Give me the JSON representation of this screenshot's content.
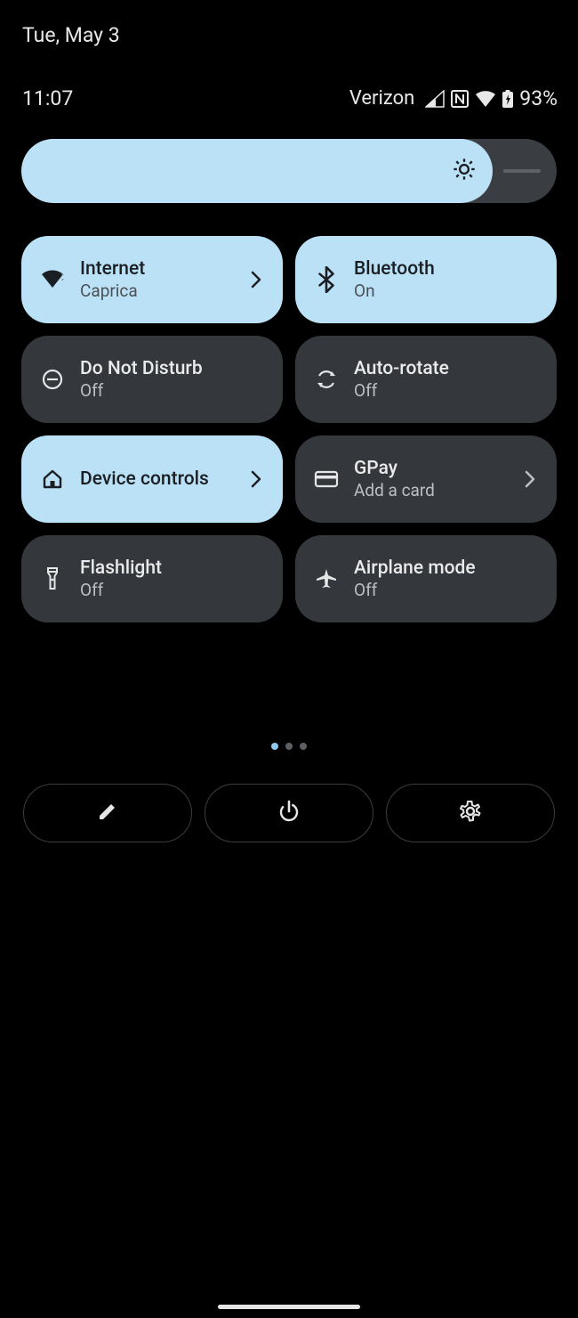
{
  "date": "Tue, May 3",
  "time": "11:07",
  "carrier": "Verizon",
  "battery": "93%",
  "brightness_percent": 88,
  "tiles": [
    {
      "title": "Internet",
      "subtitle": "Caprica",
      "on": true,
      "icon": "wifi",
      "chevron": true
    },
    {
      "title": "Bluetooth",
      "subtitle": "On",
      "on": true,
      "icon": "bluetooth",
      "chevron": false
    },
    {
      "title": "Do Not Disturb",
      "subtitle": "Off",
      "on": false,
      "icon": "dnd",
      "chevron": false
    },
    {
      "title": "Auto-rotate",
      "subtitle": "Off",
      "on": false,
      "icon": "rotate",
      "chevron": false
    },
    {
      "title": "Device controls",
      "subtitle": "",
      "on": true,
      "icon": "home",
      "chevron": true
    },
    {
      "title": "GPay",
      "subtitle": "Add a card",
      "on": false,
      "icon": "card",
      "chevron": true
    },
    {
      "title": "Flashlight",
      "subtitle": "Off",
      "on": false,
      "icon": "flashlight",
      "chevron": false
    },
    {
      "title": "Airplane mode",
      "subtitle": "Off",
      "on": false,
      "icon": "airplane",
      "chevron": false
    }
  ],
  "pages": {
    "count": 3,
    "active": 0
  }
}
